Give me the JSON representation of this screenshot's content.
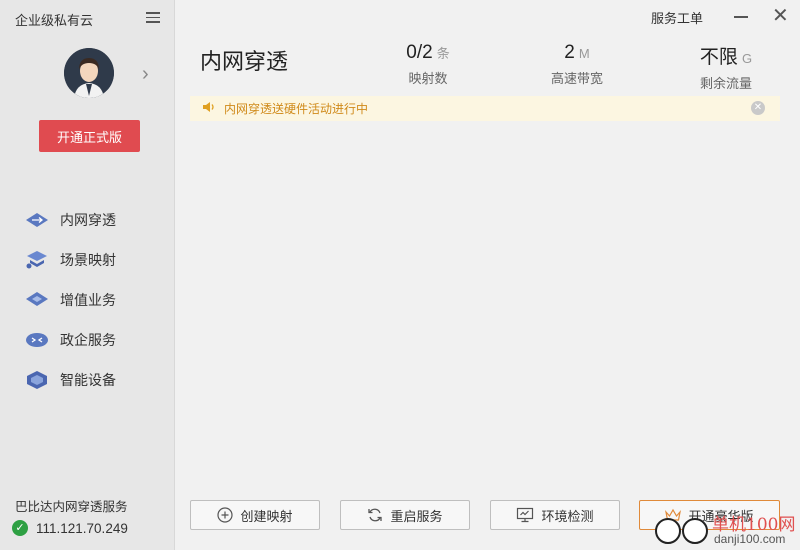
{
  "sidebar": {
    "app_title": "企业级私有云",
    "upgrade_label": "开通正式版",
    "nav": [
      {
        "label": "内网穿透",
        "icon": "network-tunnel-icon"
      },
      {
        "label": "场景映射",
        "icon": "scene-mapping-icon"
      },
      {
        "label": "增值业务",
        "icon": "value-added-icon"
      },
      {
        "label": "政企服务",
        "icon": "enterprise-service-icon"
      },
      {
        "label": "智能设备",
        "icon": "smart-device-icon"
      }
    ],
    "server_label": "巴比达内网穿透服务",
    "server_ip": "111.121.70.249"
  },
  "titlebar": {
    "ticket_label": "服务工单"
  },
  "main": {
    "title": "内网穿透",
    "stats": [
      {
        "value": "0/2",
        "unit": "条",
        "label": "映射数"
      },
      {
        "value": "2",
        "unit": "M",
        "label": "高速带宽"
      },
      {
        "value": "不限",
        "unit": "G",
        "label": "剩余流量"
      }
    ],
    "notice": "内网穿透送硬件活动进行中",
    "actions": {
      "create": "创建映射",
      "restart": "重启服务",
      "check": "环境检测",
      "premium": "开通豪华版"
    }
  },
  "watermark": {
    "text": "单机100网",
    "url": "danji100.com"
  },
  "colors": {
    "accent_red": "#e04b50",
    "notice_bg": "#fcf6e1",
    "notice_text": "#d08a1a",
    "ok_green": "#2ea043"
  }
}
